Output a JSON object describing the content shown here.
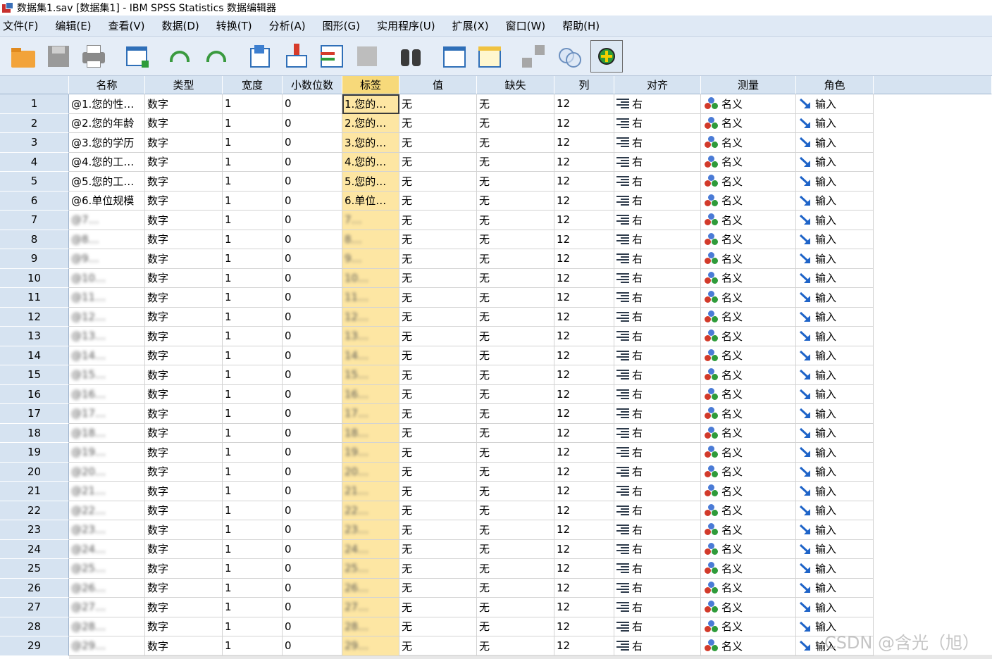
{
  "window": {
    "title": "数据集1.sav [数据集1] - IBM SPSS Statistics 数据编辑器"
  },
  "menu": [
    "文件(F)",
    "编辑(E)",
    "查看(V)",
    "数据(D)",
    "转换(T)",
    "分析(A)",
    "图形(G)",
    "实用程序(U)",
    "扩展(X)",
    "窗口(W)",
    "帮助(H)"
  ],
  "toolbar": [
    {
      "name": "open-icon"
    },
    {
      "name": "save-icon"
    },
    {
      "name": "print-icon"
    },
    {
      "name": "dialog-recall-icon"
    },
    {
      "name": "undo-icon"
    },
    {
      "name": "redo-icon"
    },
    {
      "name": "goto-case-icon"
    },
    {
      "name": "goto-variable-icon"
    },
    {
      "name": "variables-icon"
    },
    {
      "name": "run-descriptives-icon"
    },
    {
      "name": "find-icon"
    },
    {
      "name": "insert-cases-icon"
    },
    {
      "name": "insert-variable-icon"
    },
    {
      "name": "split-file-icon"
    },
    {
      "name": "select-cases-icon"
    },
    {
      "name": "value-labels-icon"
    }
  ],
  "columns": [
    "名称",
    "类型",
    "宽度",
    "小数位数",
    "标签",
    "值",
    "缺失",
    "列",
    "对齐",
    "测量",
    "角色"
  ],
  "rows": [
    {
      "num": "1",
      "name": "@1.您的性…",
      "type": "数字",
      "width": "1",
      "decimals": "0",
      "label": "1.您的…",
      "values": "无",
      "missing": "无",
      "columns": "12",
      "align": "右",
      "measure": "名义",
      "role": "输入"
    },
    {
      "num": "2",
      "name": "@2.您的年龄",
      "type": "数字",
      "width": "1",
      "decimals": "0",
      "label": "2.您的…",
      "values": "无",
      "missing": "无",
      "columns": "12",
      "align": "右",
      "measure": "名义",
      "role": "输入"
    },
    {
      "num": "3",
      "name": "@3.您的学历",
      "type": "数字",
      "width": "1",
      "decimals": "0",
      "label": "3.您的…",
      "values": "无",
      "missing": "无",
      "columns": "12",
      "align": "右",
      "measure": "名义",
      "role": "输入"
    },
    {
      "num": "4",
      "name": "@4.您的工…",
      "type": "数字",
      "width": "1",
      "decimals": "0",
      "label": "4.您的…",
      "values": "无",
      "missing": "无",
      "columns": "12",
      "align": "右",
      "measure": "名义",
      "role": "输入"
    },
    {
      "num": "5",
      "name": "@5.您的工…",
      "type": "数字",
      "width": "1",
      "decimals": "0",
      "label": "5.您的…",
      "values": "无",
      "missing": "无",
      "columns": "12",
      "align": "右",
      "measure": "名义",
      "role": "输入"
    },
    {
      "num": "6",
      "name": "@6.单位规模",
      "type": "数字",
      "width": "1",
      "decimals": "0",
      "label": "6.单位…",
      "values": "无",
      "missing": "无",
      "columns": "12",
      "align": "右",
      "measure": "名义",
      "role": "输入"
    },
    {
      "num": "7",
      "name": "@7…",
      "type": "数字",
      "width": "1",
      "decimals": "0",
      "label": "7…",
      "values": "无",
      "missing": "无",
      "columns": "12",
      "align": "右",
      "measure": "名义",
      "role": "输入",
      "obscured": true
    },
    {
      "num": "8",
      "name": "@8…",
      "type": "数字",
      "width": "1",
      "decimals": "0",
      "label": "8…",
      "values": "无",
      "missing": "无",
      "columns": "12",
      "align": "右",
      "measure": "名义",
      "role": "输入",
      "obscured": true
    },
    {
      "num": "9",
      "name": "@9…",
      "type": "数字",
      "width": "1",
      "decimals": "0",
      "label": "9…",
      "values": "无",
      "missing": "无",
      "columns": "12",
      "align": "右",
      "measure": "名义",
      "role": "输入",
      "obscured": true
    },
    {
      "num": "10",
      "name": "@10…",
      "type": "数字",
      "width": "1",
      "decimals": "0",
      "label": "10…",
      "values": "无",
      "missing": "无",
      "columns": "12",
      "align": "右",
      "measure": "名义",
      "role": "输入",
      "obscured": true
    },
    {
      "num": "11",
      "name": "@11…",
      "type": "数字",
      "width": "1",
      "decimals": "0",
      "label": "11…",
      "values": "无",
      "missing": "无",
      "columns": "12",
      "align": "右",
      "measure": "名义",
      "role": "输入",
      "obscured": true
    },
    {
      "num": "12",
      "name": "@12…",
      "type": "数字",
      "width": "1",
      "decimals": "0",
      "label": "12…",
      "values": "无",
      "missing": "无",
      "columns": "12",
      "align": "右",
      "measure": "名义",
      "role": "输入",
      "obscured": true
    },
    {
      "num": "13",
      "name": "@13…",
      "type": "数字",
      "width": "1",
      "decimals": "0",
      "label": "13…",
      "values": "无",
      "missing": "无",
      "columns": "12",
      "align": "右",
      "measure": "名义",
      "role": "输入",
      "obscured": true
    },
    {
      "num": "14",
      "name": "@14…",
      "type": "数字",
      "width": "1",
      "decimals": "0",
      "label": "14…",
      "values": "无",
      "missing": "无",
      "columns": "12",
      "align": "右",
      "measure": "名义",
      "role": "输入",
      "obscured": true
    },
    {
      "num": "15",
      "name": "@15…",
      "type": "数字",
      "width": "1",
      "decimals": "0",
      "label": "15…",
      "values": "无",
      "missing": "无",
      "columns": "12",
      "align": "右",
      "measure": "名义",
      "role": "输入",
      "obscured": true
    },
    {
      "num": "16",
      "name": "@16…",
      "type": "数字",
      "width": "1",
      "decimals": "0",
      "label": "16…",
      "values": "无",
      "missing": "无",
      "columns": "12",
      "align": "右",
      "measure": "名义",
      "role": "输入",
      "obscured": true
    },
    {
      "num": "17",
      "name": "@17…",
      "type": "数字",
      "width": "1",
      "decimals": "0",
      "label": "17…",
      "values": "无",
      "missing": "无",
      "columns": "12",
      "align": "右",
      "measure": "名义",
      "role": "输入",
      "obscured": true
    },
    {
      "num": "18",
      "name": "@18…",
      "type": "数字",
      "width": "1",
      "decimals": "0",
      "label": "18…",
      "values": "无",
      "missing": "无",
      "columns": "12",
      "align": "右",
      "measure": "名义",
      "role": "输入",
      "obscured": true
    },
    {
      "num": "19",
      "name": "@19…",
      "type": "数字",
      "width": "1",
      "decimals": "0",
      "label": "19…",
      "values": "无",
      "missing": "无",
      "columns": "12",
      "align": "右",
      "measure": "名义",
      "role": "输入",
      "obscured": true
    },
    {
      "num": "20",
      "name": "@20…",
      "type": "数字",
      "width": "1",
      "decimals": "0",
      "label": "20…",
      "values": "无",
      "missing": "无",
      "columns": "12",
      "align": "右",
      "measure": "名义",
      "role": "输入",
      "obscured": true
    },
    {
      "num": "21",
      "name": "@21…",
      "type": "数字",
      "width": "1",
      "decimals": "0",
      "label": "21…",
      "values": "无",
      "missing": "无",
      "columns": "12",
      "align": "右",
      "measure": "名义",
      "role": "输入",
      "obscured": true
    },
    {
      "num": "22",
      "name": "@22…",
      "type": "数字",
      "width": "1",
      "decimals": "0",
      "label": "22…",
      "values": "无",
      "missing": "无",
      "columns": "12",
      "align": "右",
      "measure": "名义",
      "role": "输入",
      "obscured": true
    },
    {
      "num": "23",
      "name": "@23…",
      "type": "数字",
      "width": "1",
      "decimals": "0",
      "label": "23…",
      "values": "无",
      "missing": "无",
      "columns": "12",
      "align": "右",
      "measure": "名义",
      "role": "输入",
      "obscured": true
    },
    {
      "num": "24",
      "name": "@24…",
      "type": "数字",
      "width": "1",
      "decimals": "0",
      "label": "24…",
      "values": "无",
      "missing": "无",
      "columns": "12",
      "align": "右",
      "measure": "名义",
      "role": "输入",
      "obscured": true
    },
    {
      "num": "25",
      "name": "@25…",
      "type": "数字",
      "width": "1",
      "decimals": "0",
      "label": "25…",
      "values": "无",
      "missing": "无",
      "columns": "12",
      "align": "右",
      "measure": "名义",
      "role": "输入",
      "obscured": true
    },
    {
      "num": "26",
      "name": "@26…",
      "type": "数字",
      "width": "1",
      "decimals": "0",
      "label": "26…",
      "values": "无",
      "missing": "无",
      "columns": "12",
      "align": "右",
      "measure": "名义",
      "role": "输入",
      "obscured": true
    },
    {
      "num": "27",
      "name": "@27…",
      "type": "数字",
      "width": "1",
      "decimals": "0",
      "label": "27…",
      "values": "无",
      "missing": "无",
      "columns": "12",
      "align": "右",
      "measure": "名义",
      "role": "输入",
      "obscured": true
    },
    {
      "num": "28",
      "name": "@28…",
      "type": "数字",
      "width": "1",
      "decimals": "0",
      "label": "28…",
      "values": "无",
      "missing": "无",
      "columns": "12",
      "align": "右",
      "measure": "名义",
      "role": "输入",
      "obscured": true
    },
    {
      "num": "29",
      "name": "@29…",
      "type": "数字",
      "width": "1",
      "decimals": "0",
      "label": "29…",
      "values": "无",
      "missing": "无",
      "columns": "12",
      "align": "右",
      "measure": "名义",
      "role": "输入",
      "obscured": true
    }
  ],
  "selection": {
    "column": "标签",
    "active_row": "1"
  },
  "colors": {
    "header_bg": "#d6e3f1",
    "selected_column": "#fde6a3",
    "toolbar_bg": "#e5edf7"
  },
  "watermark": "CSDN @含光（旭）"
}
